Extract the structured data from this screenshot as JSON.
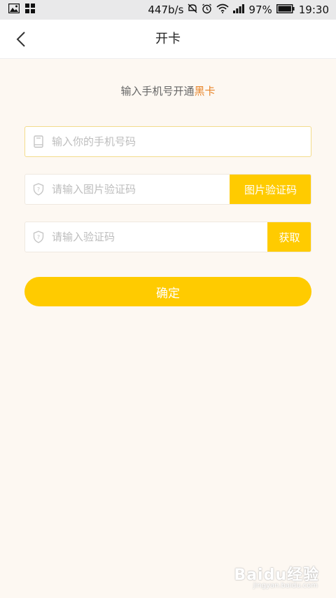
{
  "status_bar": {
    "speed": "447b/s",
    "battery": "97%",
    "time": "19:30"
  },
  "nav": {
    "title": "开卡"
  },
  "form": {
    "subtitle_prefix": "输入手机号开通",
    "subtitle_accent": "黑卡",
    "phone_placeholder": "输入你的手机号码",
    "captcha_placeholder": "请输入图片验证码",
    "captcha_button": "图片验证码",
    "code_placeholder": "请输入验证码",
    "code_button": "获取",
    "confirm_button": "确定"
  },
  "watermark": {
    "brand": "Baidu经验",
    "url": "jingyan.baidu.com"
  },
  "colors": {
    "accent": "#ffcb00",
    "accent_text": "#e8852a",
    "background": "#fdf8f2"
  }
}
